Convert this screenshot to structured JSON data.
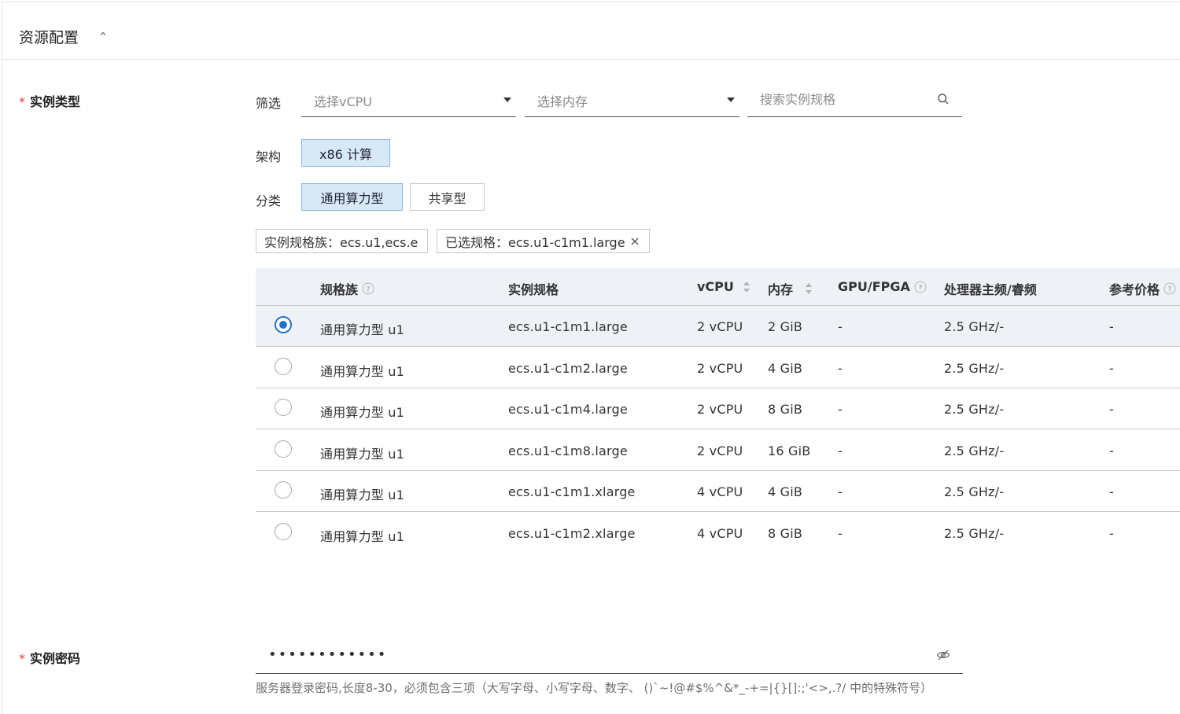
{
  "section": {
    "title": "资源配置"
  },
  "instance_type": {
    "label": "实例类型",
    "filter": {
      "label": "筛选",
      "vcpu_placeholder": "选择vCPU",
      "memory_placeholder": "选择内存",
      "search_placeholder": "搜索实例规格"
    },
    "arch": {
      "label": "架构",
      "options": [
        "x86 计算"
      ],
      "selected": "x86 计算"
    },
    "category": {
      "label": "分类",
      "options": [
        "通用算力型",
        "共享型"
      ],
      "selected": "通用算力型"
    },
    "tags": {
      "family": "实例规格族：ecs.u1,ecs.e",
      "selected_spec": "已选规格：ecs.u1-c1m1.large"
    },
    "table": {
      "headers": {
        "family": "规格族",
        "spec": "实例规格",
        "vcpu": "vCPU",
        "memory": "内存",
        "gpu": "GPU/FPGA",
        "cpu_freq": "处理器主频/睿频",
        "price": "参考价格"
      },
      "rows": [
        {
          "family": "通用算力型 u1",
          "spec": "ecs.u1-c1m1.large",
          "vcpu": "2 vCPU",
          "memory": "2 GiB",
          "gpu": "-",
          "cpu_freq": "2.5 GHz/-",
          "price": "-",
          "selected": true
        },
        {
          "family": "通用算力型 u1",
          "spec": "ecs.u1-c1m2.large",
          "vcpu": "2 vCPU",
          "memory": "4 GiB",
          "gpu": "-",
          "cpu_freq": "2.5 GHz/-",
          "price": "-",
          "selected": false
        },
        {
          "family": "通用算力型 u1",
          "spec": "ecs.u1-c1m4.large",
          "vcpu": "2 vCPU",
          "memory": "8 GiB",
          "gpu": "-",
          "cpu_freq": "2.5 GHz/-",
          "price": "-",
          "selected": false
        },
        {
          "family": "通用算力型 u1",
          "spec": "ecs.u1-c1m8.large",
          "vcpu": "2 vCPU",
          "memory": "16 GiB",
          "gpu": "-",
          "cpu_freq": "2.5 GHz/-",
          "price": "-",
          "selected": false
        },
        {
          "family": "通用算力型 u1",
          "spec": "ecs.u1-c1m1.xlarge",
          "vcpu": "4 vCPU",
          "memory": "4 GiB",
          "gpu": "-",
          "cpu_freq": "2.5 GHz/-",
          "price": "-",
          "selected": false
        },
        {
          "family": "通用算力型 u1",
          "spec": "ecs.u1-c1m2.xlarge",
          "vcpu": "4 vCPU",
          "memory": "8 GiB",
          "gpu": "-",
          "cpu_freq": "2.5 GHz/-",
          "price": "-",
          "selected": false
        }
      ]
    }
  },
  "password": {
    "label": "实例密码",
    "value": "••••••••••••",
    "hint": "服务器登录密码,长度8-30，必须包含三项（大写字母、小写字母、数字、 ()`~!@#$%^&*_-+=|{}[]:;'<>,.?/ 中的特殊符号）"
  },
  "colors": {
    "accent": "#2371c9",
    "required": "#e23c39",
    "selected_bg": "#eef2f7",
    "chip_active_bg": "#d7e9f7"
  },
  "icons": [
    "chevron-up-icon",
    "caret-down-icon",
    "search-icon",
    "close-icon",
    "help-icon",
    "sort-icon",
    "eye-off-icon"
  ]
}
